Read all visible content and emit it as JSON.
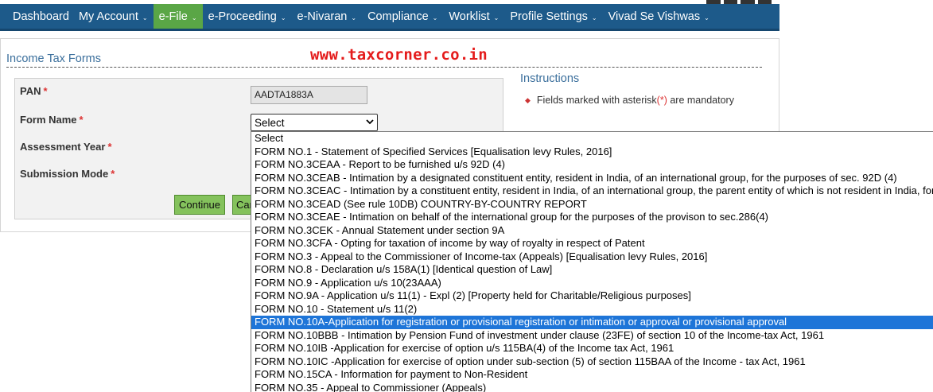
{
  "nav": {
    "items": [
      {
        "label": "Dashboard",
        "caret": false,
        "active": false
      },
      {
        "label": "My Account",
        "caret": true,
        "active": false
      },
      {
        "label": "e-File",
        "caret": true,
        "active": true
      },
      {
        "label": "e-Proceeding",
        "caret": true,
        "active": false
      },
      {
        "label": "e-Nivaran",
        "caret": true,
        "active": false
      },
      {
        "label": "Compliance",
        "caret": true,
        "active": false
      },
      {
        "label": "Worklist",
        "caret": true,
        "active": false
      },
      {
        "label": "Profile Settings",
        "caret": true,
        "active": false
      },
      {
        "label": "Vivad Se Vishwas",
        "caret": true,
        "active": false
      }
    ],
    "caret_glyph": "⌄",
    "active_color": "#5aa646",
    "bar_color": "#1d5a8a"
  },
  "page": {
    "section_title": "Income Tax Forms",
    "watermark": "www.taxcorner.co.in"
  },
  "form": {
    "pan_label": "PAN",
    "pan_value": "AADTA1883A",
    "form_name_label": "Form Name",
    "form_name_selected": "Select",
    "assessment_year_label": "Assessment Year",
    "submission_mode_label": "Submission Mode",
    "required_marker": "*",
    "continue_label": "Continue",
    "cancel_label": "Cancel"
  },
  "instructions": {
    "title": "Instructions",
    "bullet": "◆",
    "item_prefix": "Fields marked with asterisk",
    "item_asterisk": "(*)",
    "item_suffix": " are mandatory"
  },
  "dropdown": {
    "selected_index": 14,
    "options": [
      "Select",
      "FORM NO.1 - Statement of Specified Services [Equalisation levy Rules, 2016]",
      "FORM NO.3CEAA - Report to be furnished u/s 92D (4)",
      "FORM NO.3CEAB - Intimation by a designated constituent entity, resident in India, of an international group, for the purposes of sec. 92D (4)",
      "FORM NO.3CEAC - Intimation by a constituent entity, resident in India, of an international group, the parent entity of which is not resident in India, for",
      "FORM NO.3CEAD (See rule 10DB) COUNTRY-BY-COUNTRY REPORT",
      "FORM NO.3CEAE - Intimation on behalf of the international group for the purposes of the provison to sec.286(4)",
      "FORM NO.3CEK - Annual Statement under section 9A",
      "FORM NO.3CFA - Opting for taxation of income by way of royalty in respect of Patent",
      "FORM NO.3 - Appeal to the Commissioner of Income-tax (Appeals) [Equalisation levy Rules, 2016]",
      "FORM NO.8 - Declaration u/s 158A(1) [Identical question of Law]",
      "FORM NO.9 - Application u/s 10(23AAA)",
      "FORM NO.9A - Application u/s 11(1) - Expl (2) [Property held for Charitable/Religious purposes]",
      "FORM NO.10 - Statement u/s 11(2)",
      "FORM NO.10A-Application for registration or provisional registration or intimation or approval or provisional approval",
      "FORM NO.10BBB - Intimation by Pension Fund of investment under clause (23FE) of section 10 of the Income-tax Act, 1961",
      "FORM NO.10IB -Application for exercise of option u/s 115BA(4) of the Income tax Act, 1961",
      "FORM NO.10IC -Application for exercise of option under sub-section (5) of section 115BAA of the Income - tax Act, 1961",
      "FORM NO.15CA - Information for payment to Non-Resident",
      "FORM NO.35 - Appeal to Commissioner (Appeals)"
    ],
    "highlight_color": "#1e75d8"
  }
}
